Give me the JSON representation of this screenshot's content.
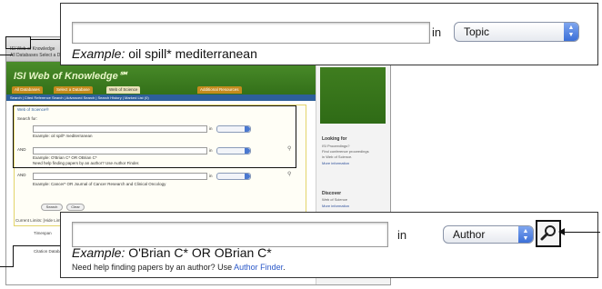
{
  "background_window": {
    "toolbar_line1": "ISI Web of Knowledge",
    "toolbar_line2": "All Databases   Select a Database   Web of Science",
    "logo": "ISI Web of Knowledge℠",
    "tabs": [
      "All Databases",
      "Select a Database",
      "Web of Science",
      "Additional Resources"
    ],
    "nav": "Search | Cited Reference Search | Advanced Search | Search History | Marked List (0)",
    "search_area_title": "Web of Science®",
    "search_for_label": "Search for:",
    "row1": {
      "example": "Example: oil spill* mediterranean",
      "field": "Topic"
    },
    "row2": {
      "example": "Example: O'Brian C* OR OBrian C*",
      "help": "Need help finding papers by an author? Use Author Finder.",
      "field": "Author"
    },
    "row3": {
      "example": "Example: Cancer* OR Journal of Cancer Research and Clinical Oncology",
      "field": "Publication Name"
    },
    "op_and": "AND",
    "in_label": "in",
    "search_button": "Search",
    "clear_button": "Clear",
    "current_limits": "Current Limits: [Hide Limits and Settings] (To save these permanently, sign in or register.)",
    "timespan_label": "Timespan",
    "citation_label": "Citation Databases:",
    "sidebar": {
      "looking_for": "Looking for",
      "lines": [
        "ISI Proceedings?",
        "Find conference proceedings",
        "in Web of Science."
      ],
      "link1": "More information",
      "discover": "Discover",
      "discover_sub": "Web of Science",
      "link2": "More information"
    }
  },
  "callout_top": {
    "search_value": "",
    "in_label": "in",
    "field_value": "Topic",
    "example_label": "Example:",
    "example_text": " oil spill* mediterranean"
  },
  "callout_bottom": {
    "search_value": "",
    "in_label": "in",
    "field_value": "Author",
    "example_label": "Example:",
    "example_text": " O'Brian C* OR OBrian C*",
    "help_text": "Need help finding papers by an author? Use ",
    "help_link": "Author Finder",
    "help_end": ".",
    "search_icon": "magnifier-icon"
  }
}
